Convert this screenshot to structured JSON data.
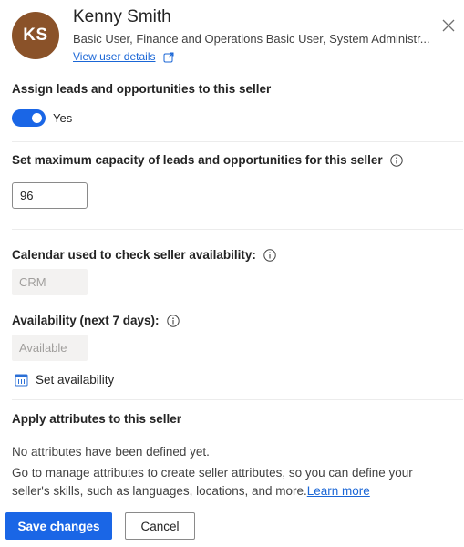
{
  "user": {
    "initials": "KS",
    "name": "Kenny Smith",
    "roles": "Basic User, Finance and Operations Basic User, System Administr...",
    "view_details_link": "View user details",
    "avatar_color": "#8a5229"
  },
  "assign": {
    "title": "Assign leads and opportunities to this seller",
    "toggle_on": true,
    "toggle_label": "Yes"
  },
  "capacity": {
    "title": "Set maximum capacity of leads and opportunities for this seller",
    "value": "96"
  },
  "calendar": {
    "title": "Calendar used to check seller availability:",
    "value": "CRM"
  },
  "availability": {
    "title": "Availability (next 7 days):",
    "value": "Available",
    "set_availability_label": "Set availability"
  },
  "attributes": {
    "title": "Apply attributes to this seller",
    "empty_message": "No attributes have been defined yet.",
    "description": "Go to manage attributes to create seller attributes, so you can define your seller's skills, such as languages, locations, and more.",
    "learn_more": "Learn more"
  },
  "actions": {
    "save_label": "Save changes",
    "cancel_label": "Cancel"
  },
  "colors": {
    "accent": "#1a66e6",
    "link": "#1a66d6"
  }
}
